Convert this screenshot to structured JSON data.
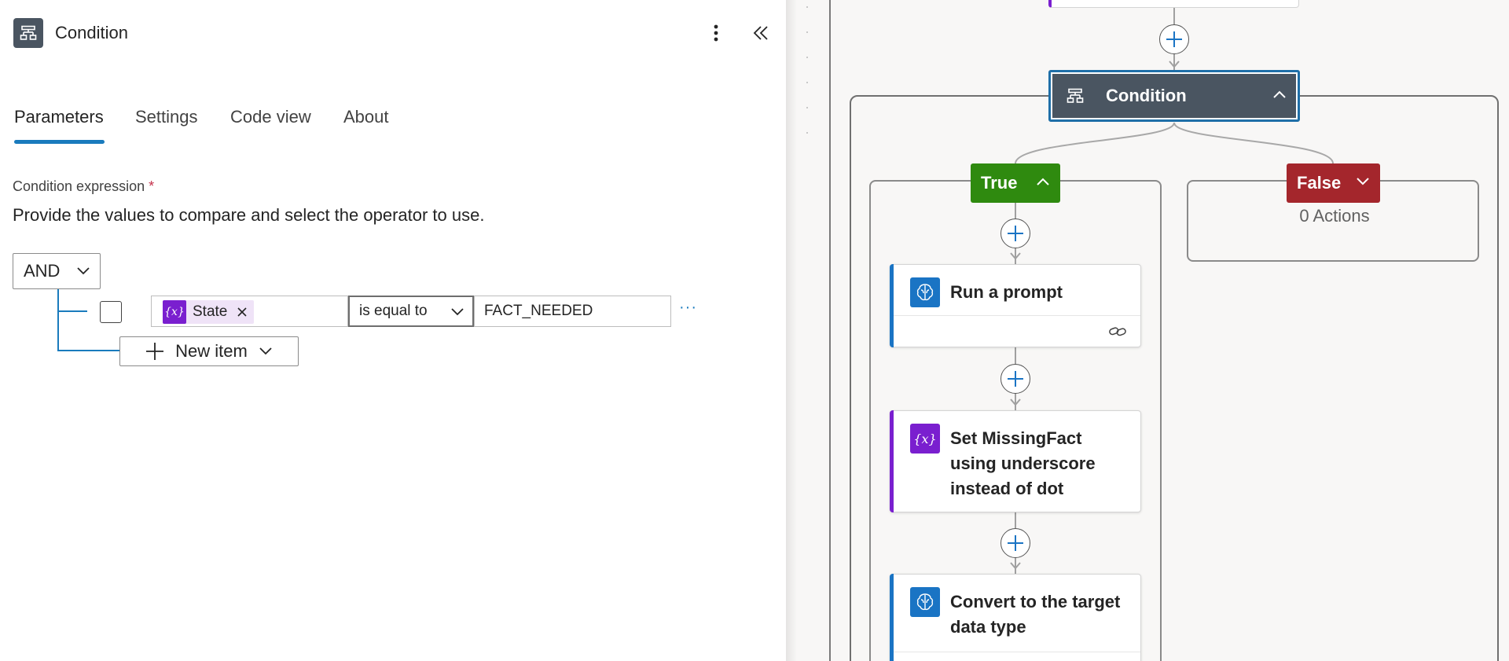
{
  "panel": {
    "title": "Condition",
    "icon": "condition-icon",
    "tabs": [
      {
        "label": "Parameters",
        "active": true
      },
      {
        "label": "Settings",
        "active": false
      },
      {
        "label": "Code view",
        "active": false
      },
      {
        "label": "About",
        "active": false
      }
    ],
    "condition_label": "Condition expression",
    "required_marker": "*",
    "description": "Provide the values to compare and select the operator to use.",
    "group_operator": "AND",
    "row": {
      "token_label": "State",
      "token_icon": "{x}",
      "operator": "is equal to",
      "value": "FACT_NEEDED",
      "more": "···"
    },
    "new_item_label": "New item"
  },
  "canvas": {
    "condition_node_label": "Condition",
    "branch_true_label": "True",
    "branch_false_label": "False",
    "false_actions_text": "0 Actions",
    "cards": [
      {
        "title": "Run a prompt",
        "icon": "ai-brain-icon",
        "color": "#1a74c4"
      },
      {
        "title": "Set MissingFact using underscore instead of dot",
        "icon": "{x}",
        "color": "#7a1fcf"
      },
      {
        "title": "Convert to the target data type",
        "icon": "ai-brain-icon",
        "color": "#1a74c4"
      }
    ]
  },
  "colors": {
    "accent": "#1a7bbd",
    "true_branch": "#2f8a0f",
    "false_branch": "#a4262c",
    "condition_node": "#4a5561",
    "variable": "#7a1fcf",
    "ai": "#1a74c4"
  }
}
